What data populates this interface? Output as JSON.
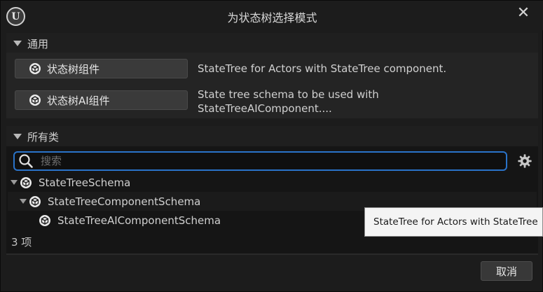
{
  "window": {
    "title": "为状态树选择模式",
    "logo_letter": "U",
    "close_glyph": "✕"
  },
  "general": {
    "header": "通用",
    "modes": [
      {
        "label": "状态树组件",
        "description_lines": [
          "StateTree for Actors with StateTree component."
        ],
        "icon": "cube-icon"
      },
      {
        "label": "状态树AI组件",
        "description_lines": [
          "State tree schema to be used with",
          "StateTreeAIComponent...."
        ],
        "icon": "cube-icon"
      }
    ]
  },
  "all_classes": {
    "header": "所有类",
    "search": {
      "placeholder": "搜索",
      "value": ""
    },
    "tree": [
      {
        "name": "StateTreeSchema",
        "expanded": true,
        "icon": "cube-icon"
      },
      {
        "name": "StateTreeComponentSchema",
        "expanded": true,
        "icon": "cube-icon"
      },
      {
        "name": "StateTreeAIComponentSchema",
        "expanded": false,
        "icon": "cube-icon"
      }
    ],
    "item_count": "3 项"
  },
  "tooltip": {
    "text": "StateTree for Actors with StateTree"
  },
  "footer": {
    "cancel_label": "取消"
  },
  "colors": {
    "accent_focus": "#2a73c9",
    "background": "#1c1c1c",
    "tooltip_bg": "#f4f4f4"
  }
}
